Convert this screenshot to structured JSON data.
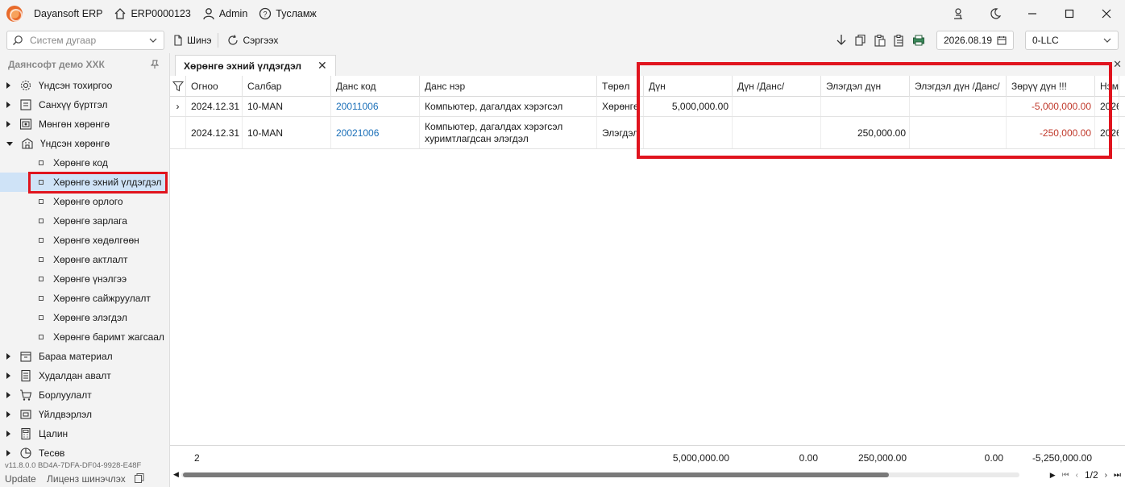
{
  "app": {
    "name": "Dayansoft ERP",
    "company_code": "ERP0000123",
    "user": "Admin",
    "help": "Тусламж"
  },
  "toolbar": {
    "search_placeholder": "Систем дугаар",
    "new_label": "Шинэ",
    "refresh_label": "Сэргээх",
    "date": "2026.08.19",
    "company_select": "0-LLC"
  },
  "sidebar": {
    "title": "Даянсофт демо ХХК",
    "items": [
      {
        "label": "Үндсэн тохиргоо",
        "icon": "gear-icon",
        "state": "collapsed"
      },
      {
        "label": "Санхүү бүртгэл",
        "icon": "ledger-icon",
        "state": "collapsed"
      },
      {
        "label": "Мөнгөн хөрөнгө",
        "icon": "cash-icon",
        "state": "collapsed"
      },
      {
        "label": "Үндсэн хөрөнгө",
        "icon": "building-icon",
        "state": "expanded"
      }
    ],
    "subitems": [
      "Хөрөнгө код",
      "Хөрөнгө эхний үлдэгдэл",
      "Хөрөнгө орлого",
      "Хөрөнгө зарлага",
      "Хөрөнгө хөдөлгөөн",
      "Хөрөнгө актлалт",
      "Хөрөнгө үнэлгээ",
      "Хөрөнгө сайжруулалт",
      "Хөрөнгө элэгдэл",
      "Хөрөнгө баримт жагсаал"
    ],
    "items_after": [
      {
        "label": "Бараа материал",
        "icon": "box-icon"
      },
      {
        "label": "Худалдан авалт",
        "icon": "purchase-icon"
      },
      {
        "label": "Борлуулалт",
        "icon": "cart-icon"
      },
      {
        "label": "Үйлдвэрлэл",
        "icon": "factory-icon"
      },
      {
        "label": "Цалин",
        "icon": "calculator-icon"
      },
      {
        "label": "Тесөв",
        "icon": "pie-icon"
      }
    ],
    "version": "v11.8.0.0   BD4A-7DFA-DF04-9928-E48F",
    "update": "Update",
    "license": "Лиценз шинэчлэх"
  },
  "tab": {
    "title": "Хөрөнгө эхний үлдэгдэл"
  },
  "grid": {
    "columns": [
      "Огноо",
      "Салбар",
      "Данс код",
      "Данс нэр",
      "Төрөл",
      "Дүн",
      "Дүн /Данс/",
      "Элэгдэл дүн",
      "Элэгдэл дүн /Данс/",
      "Зөрүү дүн !!!",
      "Нэм"
    ],
    "rows": [
      {
        "date": "2024.12.31",
        "branch": "10-MAN",
        "code": "20011006",
        "name": "Компьютер, дагалдах хэрэгсэл",
        "type": "Хөрөнгө",
        "amount": "5,000,000.00",
        "amount_acc": "",
        "dep": "",
        "dep_acc": "",
        "diff": "-5,000,000.00",
        "no": "2026"
      },
      {
        "date": "2024.12.31",
        "branch": "10-MAN",
        "code": "20021006",
        "name": "Компьютер, дагалдах хэрэгсэл хуримтлагдсан элэгдэл",
        "type": "Элэгдэл",
        "amount": "",
        "amount_acc": "",
        "dep": "250,000.00",
        "dep_acc": "",
        "diff": "-250,000.00",
        "no": "2026"
      }
    ],
    "footer": {
      "count": "2",
      "amount": "5,000,000.00",
      "amount_acc": "0.00",
      "dep": "250,000.00",
      "dep_acc": "0.00",
      "diff": "-5,250,000.00"
    },
    "pager": "1/2"
  },
  "colors": {
    "highlight": "#e0141e",
    "link": "#1a6fb8",
    "negative": "#c0392b",
    "selected_bg": "#cfe3f7"
  }
}
